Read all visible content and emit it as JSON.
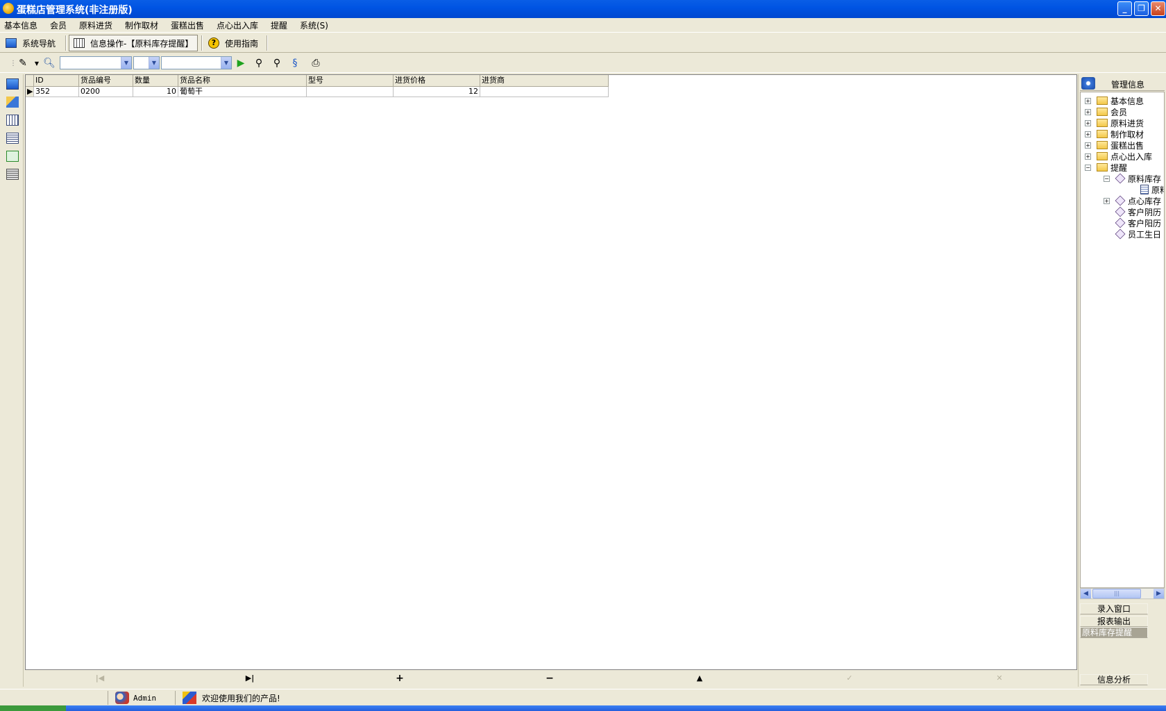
{
  "window": {
    "title": "蛋糕店管理系统(非注册版)",
    "buttons": {
      "minimize": "_",
      "restore": "❐",
      "close": "✕"
    }
  },
  "menu": [
    "基本信息",
    "会员",
    "原料进货",
    "制作取材",
    "蛋糕出售",
    "点心出入库",
    "提醒",
    "系统(S)"
  ],
  "nav": {
    "system_nav": "系统导航",
    "info_op": "信息操作-【原料库存提醒】",
    "guide": "使用指南"
  },
  "table": {
    "columns": [
      "ID",
      "货品编号",
      "数量",
      "货品名称",
      "型号",
      "进货价格",
      "进货商"
    ],
    "rows": [
      [
        "352",
        "0200",
        "10",
        "葡萄干",
        "",
        "12",
        ""
      ]
    ]
  },
  "navigator": {
    "first": "|◀",
    "last": "▶|",
    "insert": "+",
    "delete": "−",
    "edit": "▲",
    "post": "✓",
    "cancel": "✕"
  },
  "right_panel": {
    "header": "管理信息",
    "tree": [
      {
        "label": "基本信息",
        "expander": "+"
      },
      {
        "label": "会员",
        "expander": "+"
      },
      {
        "label": "原料进货",
        "expander": "+"
      },
      {
        "label": "制作取材",
        "expander": "+"
      },
      {
        "label": "蛋糕出售",
        "expander": "+"
      },
      {
        "label": "点心出入库",
        "expander": "+"
      },
      {
        "label": "提醒",
        "expander": "−"
      }
    ],
    "subtree": [
      {
        "label": "原料库存",
        "expander": "−"
      },
      {
        "label": "原料"
      },
      {
        "label": "点心库存",
        "expander": "+"
      },
      {
        "label": "客户阴历"
      },
      {
        "label": "客户阳历"
      },
      {
        "label": "员工生日"
      }
    ],
    "scroll_thumb": "|||",
    "buttons": {
      "input_window": "录入窗口",
      "report_output": "报表输出",
      "selected": "原料库存提醒",
      "analysis": "信息分析"
    }
  },
  "status": {
    "user": "Admin",
    "message": "欢迎使用我们的产品!"
  }
}
